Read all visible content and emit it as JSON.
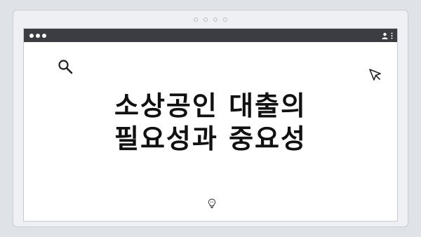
{
  "slide": {
    "title_line1": "소상공인 대출의",
    "title_line2": "필요성과 중요성"
  },
  "icons": {
    "search": "search-icon",
    "cursor": "cursor-icon",
    "bulb": "lightbulb-icon",
    "profile": "profile-icon",
    "menu": "kebab-menu-icon"
  },
  "colors": {
    "background": "#dfe3e8",
    "titlebar": "#3b3d42",
    "text": "#111111"
  }
}
